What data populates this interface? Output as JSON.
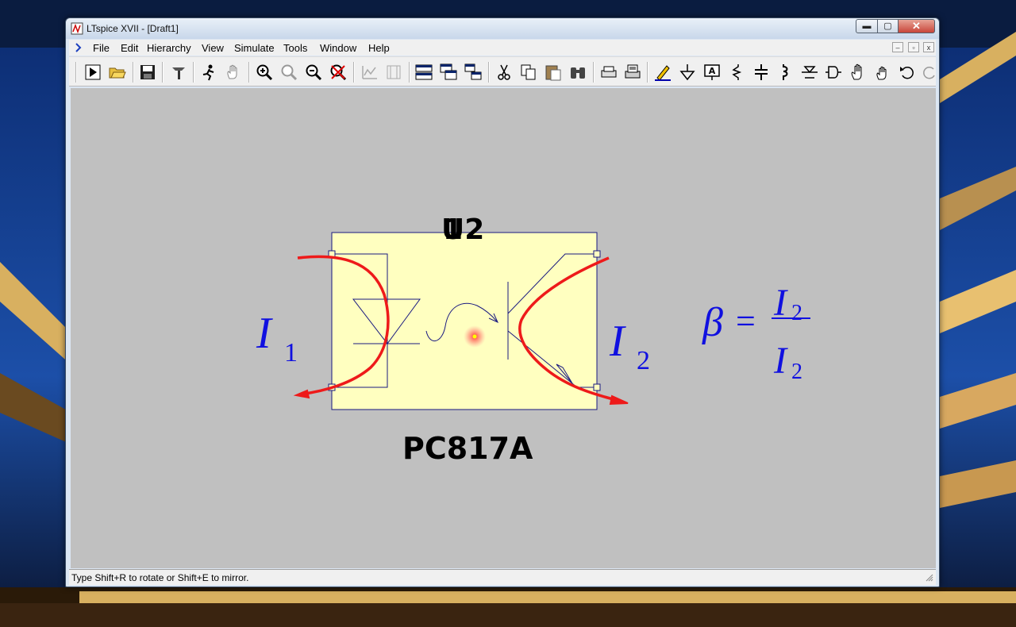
{
  "window": {
    "title": "LTspice XVII - [Draft1]"
  },
  "caption_buttons": {
    "minimize": "▬",
    "maximize": "▢",
    "close": "✕"
  },
  "menu": [
    "File",
    "Edit",
    "Hierarchy",
    "View",
    "Simulate",
    "Tools",
    "Window",
    "Help"
  ],
  "mdi_buttons": {
    "minimize": "–",
    "restore": "▫",
    "close": "x"
  },
  "schematic": {
    "ref_designator": "U2",
    "ref_designator_overlap": "1",
    "part_name": "PC817A",
    "current_in": {
      "symbol": "I",
      "subscript": "1"
    },
    "current_out": {
      "symbol": "I",
      "subscript": "2"
    },
    "formula": {
      "lhs": "β",
      "eq": "=",
      "num": "I",
      "num_sub": "2",
      "den": "I",
      "den_sub": "2"
    }
  },
  "status": {
    "text": "Type Shift+R to rotate or Shift+E to mirror."
  },
  "toolbar_icons": [
    "run-icon",
    "open-icon",
    "save-icon",
    "control-panel-icon",
    "halt-icon",
    "pan-icon",
    "zoom-in-icon",
    "zoom-full-icon",
    "zoom-out-icon",
    "zoom-cancel-icon",
    "autorange-icon",
    "tile-icon",
    "cascade-icon",
    "window-arrange-icon",
    "cut-icon",
    "copy-icon",
    "paste-icon",
    "find-icon",
    "print-setup-icon",
    "print-icon",
    "draw-wire-icon",
    "ground-icon",
    "label-net-icon",
    "resistor-icon",
    "capacitor-icon",
    "inductor-icon",
    "diode-icon",
    "component-icon",
    "move-icon",
    "drag-icon",
    "undo-icon",
    "redo-icon"
  ]
}
